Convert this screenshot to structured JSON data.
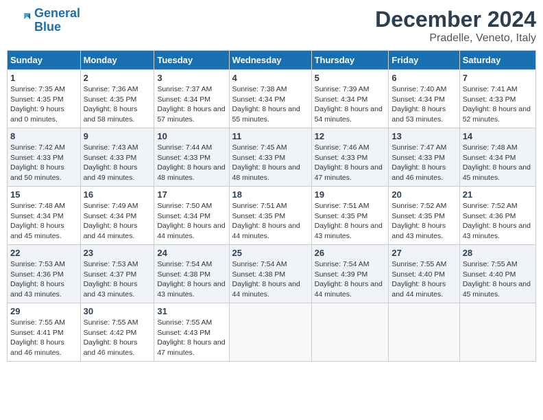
{
  "logo": {
    "line1": "General",
    "line2": "Blue"
  },
  "title": "December 2024",
  "location": "Pradelle, Veneto, Italy",
  "days_of_week": [
    "Sunday",
    "Monday",
    "Tuesday",
    "Wednesday",
    "Thursday",
    "Friday",
    "Saturday"
  ],
  "weeks": [
    [
      {
        "day": "1",
        "sunrise": "Sunrise: 7:35 AM",
        "sunset": "Sunset: 4:35 PM",
        "daylight": "Daylight: 9 hours and 0 minutes."
      },
      {
        "day": "2",
        "sunrise": "Sunrise: 7:36 AM",
        "sunset": "Sunset: 4:35 PM",
        "daylight": "Daylight: 8 hours and 58 minutes."
      },
      {
        "day": "3",
        "sunrise": "Sunrise: 7:37 AM",
        "sunset": "Sunset: 4:34 PM",
        "daylight": "Daylight: 8 hours and 57 minutes."
      },
      {
        "day": "4",
        "sunrise": "Sunrise: 7:38 AM",
        "sunset": "Sunset: 4:34 PM",
        "daylight": "Daylight: 8 hours and 55 minutes."
      },
      {
        "day": "5",
        "sunrise": "Sunrise: 7:39 AM",
        "sunset": "Sunset: 4:34 PM",
        "daylight": "Daylight: 8 hours and 54 minutes."
      },
      {
        "day": "6",
        "sunrise": "Sunrise: 7:40 AM",
        "sunset": "Sunset: 4:34 PM",
        "daylight": "Daylight: 8 hours and 53 minutes."
      },
      {
        "day": "7",
        "sunrise": "Sunrise: 7:41 AM",
        "sunset": "Sunset: 4:33 PM",
        "daylight": "Daylight: 8 hours and 52 minutes."
      }
    ],
    [
      {
        "day": "8",
        "sunrise": "Sunrise: 7:42 AM",
        "sunset": "Sunset: 4:33 PM",
        "daylight": "Daylight: 8 hours and 50 minutes."
      },
      {
        "day": "9",
        "sunrise": "Sunrise: 7:43 AM",
        "sunset": "Sunset: 4:33 PM",
        "daylight": "Daylight: 8 hours and 49 minutes."
      },
      {
        "day": "10",
        "sunrise": "Sunrise: 7:44 AM",
        "sunset": "Sunset: 4:33 PM",
        "daylight": "Daylight: 8 hours and 48 minutes."
      },
      {
        "day": "11",
        "sunrise": "Sunrise: 7:45 AM",
        "sunset": "Sunset: 4:33 PM",
        "daylight": "Daylight: 8 hours and 48 minutes."
      },
      {
        "day": "12",
        "sunrise": "Sunrise: 7:46 AM",
        "sunset": "Sunset: 4:33 PM",
        "daylight": "Daylight: 8 hours and 47 minutes."
      },
      {
        "day": "13",
        "sunrise": "Sunrise: 7:47 AM",
        "sunset": "Sunset: 4:33 PM",
        "daylight": "Daylight: 8 hours and 46 minutes."
      },
      {
        "day": "14",
        "sunrise": "Sunrise: 7:48 AM",
        "sunset": "Sunset: 4:34 PM",
        "daylight": "Daylight: 8 hours and 45 minutes."
      }
    ],
    [
      {
        "day": "15",
        "sunrise": "Sunrise: 7:48 AM",
        "sunset": "Sunset: 4:34 PM",
        "daylight": "Daylight: 8 hours and 45 minutes."
      },
      {
        "day": "16",
        "sunrise": "Sunrise: 7:49 AM",
        "sunset": "Sunset: 4:34 PM",
        "daylight": "Daylight: 8 hours and 44 minutes."
      },
      {
        "day": "17",
        "sunrise": "Sunrise: 7:50 AM",
        "sunset": "Sunset: 4:34 PM",
        "daylight": "Daylight: 8 hours and 44 minutes."
      },
      {
        "day": "18",
        "sunrise": "Sunrise: 7:51 AM",
        "sunset": "Sunset: 4:35 PM",
        "daylight": "Daylight: 8 hours and 44 minutes."
      },
      {
        "day": "19",
        "sunrise": "Sunrise: 7:51 AM",
        "sunset": "Sunset: 4:35 PM",
        "daylight": "Daylight: 8 hours and 43 minutes."
      },
      {
        "day": "20",
        "sunrise": "Sunrise: 7:52 AM",
        "sunset": "Sunset: 4:35 PM",
        "daylight": "Daylight: 8 hours and 43 minutes."
      },
      {
        "day": "21",
        "sunrise": "Sunrise: 7:52 AM",
        "sunset": "Sunset: 4:36 PM",
        "daylight": "Daylight: 8 hours and 43 minutes."
      }
    ],
    [
      {
        "day": "22",
        "sunrise": "Sunrise: 7:53 AM",
        "sunset": "Sunset: 4:36 PM",
        "daylight": "Daylight: 8 hours and 43 minutes."
      },
      {
        "day": "23",
        "sunrise": "Sunrise: 7:53 AM",
        "sunset": "Sunset: 4:37 PM",
        "daylight": "Daylight: 8 hours and 43 minutes."
      },
      {
        "day": "24",
        "sunrise": "Sunrise: 7:54 AM",
        "sunset": "Sunset: 4:38 PM",
        "daylight": "Daylight: 8 hours and 43 minutes."
      },
      {
        "day": "25",
        "sunrise": "Sunrise: 7:54 AM",
        "sunset": "Sunset: 4:38 PM",
        "daylight": "Daylight: 8 hours and 44 minutes."
      },
      {
        "day": "26",
        "sunrise": "Sunrise: 7:54 AM",
        "sunset": "Sunset: 4:39 PM",
        "daylight": "Daylight: 8 hours and 44 minutes."
      },
      {
        "day": "27",
        "sunrise": "Sunrise: 7:55 AM",
        "sunset": "Sunset: 4:40 PM",
        "daylight": "Daylight: 8 hours and 44 minutes."
      },
      {
        "day": "28",
        "sunrise": "Sunrise: 7:55 AM",
        "sunset": "Sunset: 4:40 PM",
        "daylight": "Daylight: 8 hours and 45 minutes."
      }
    ],
    [
      {
        "day": "29",
        "sunrise": "Sunrise: 7:55 AM",
        "sunset": "Sunset: 4:41 PM",
        "daylight": "Daylight: 8 hours and 46 minutes."
      },
      {
        "day": "30",
        "sunrise": "Sunrise: 7:55 AM",
        "sunset": "Sunset: 4:42 PM",
        "daylight": "Daylight: 8 hours and 46 minutes."
      },
      {
        "day": "31",
        "sunrise": "Sunrise: 7:55 AM",
        "sunset": "Sunset: 4:43 PM",
        "daylight": "Daylight: 8 hours and 47 minutes."
      },
      null,
      null,
      null,
      null
    ]
  ]
}
